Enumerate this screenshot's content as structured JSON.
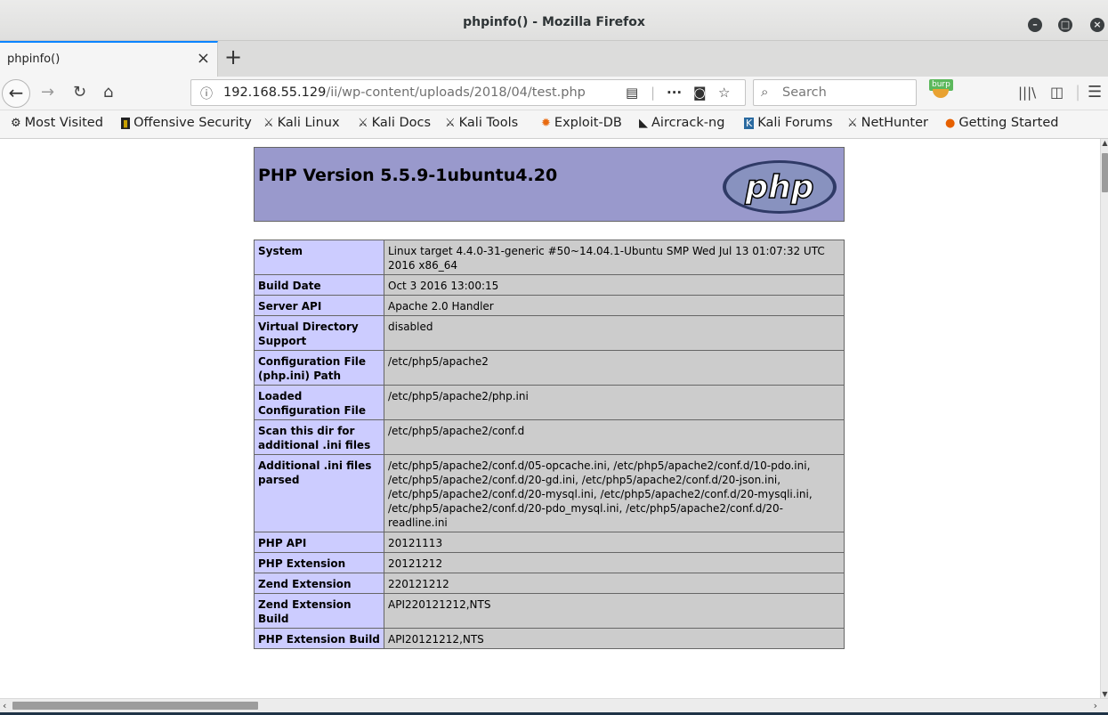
{
  "window": {
    "title": "phpinfo() - Mozilla Firefox",
    "controls": [
      "minimize",
      "maximize",
      "close"
    ]
  },
  "tabs": [
    {
      "label": "phpinfo()",
      "active": true
    }
  ],
  "nav": {
    "url_host": "192.168.55.129",
    "url_path": "/ii/wp-content/uploads/2018/04/test.php",
    "search_placeholder": "Search",
    "burp_label": "burp",
    "icons": [
      "back-icon",
      "forward-icon",
      "reload-icon",
      "home-icon",
      "info-icon",
      "reader-icon",
      "more-icon",
      "pocket-icon",
      "bookmark-star-icon",
      "search-icon",
      "library-icon",
      "sidebar-icon",
      "menu-icon"
    ]
  },
  "bookmarks": [
    {
      "label": "Most Visited",
      "icon": "gear-icon"
    },
    {
      "label": "Offensive Security",
      "icon": "offsec-icon"
    },
    {
      "label": "Kali Linux",
      "icon": "kali-icon"
    },
    {
      "label": "Kali Docs",
      "icon": "kali-icon"
    },
    {
      "label": "Kali Tools",
      "icon": "kali-icon"
    },
    {
      "label": "Exploit-DB",
      "icon": "exploitdb-icon"
    },
    {
      "label": "Aircrack-ng",
      "icon": "aircrack-icon"
    },
    {
      "label": "Kali Forums",
      "icon": "kali-forums-icon"
    },
    {
      "label": "NetHunter",
      "icon": "kali-icon"
    },
    {
      "label": "Getting Started",
      "icon": "firefox-icon"
    }
  ],
  "page": {
    "heading": "PHP Version 5.5.9-1ubuntu4.20",
    "logo_text": "php",
    "header_bg": "#9999cc",
    "key_bg": "#ccccff",
    "value_bg": "#cccccc",
    "rows": [
      {
        "key": "System",
        "value": "Linux target 4.4.0-31-generic #50~14.04.1-Ubuntu SMP Wed Jul 13 01:07:32 UTC 2016 x86_64"
      },
      {
        "key": "Build Date",
        "value": "Oct 3 2016 13:00:15"
      },
      {
        "key": "Server API",
        "value": "Apache 2.0 Handler"
      },
      {
        "key": "Virtual Directory Support",
        "value": "disabled"
      },
      {
        "key": "Configuration File (php.ini) Path",
        "value": "/etc/php5/apache2"
      },
      {
        "key": "Loaded Configuration File",
        "value": "/etc/php5/apache2/php.ini"
      },
      {
        "key": "Scan this dir for additional .ini files",
        "value": "/etc/php5/apache2/conf.d"
      },
      {
        "key": "Additional .ini files parsed",
        "value": "/etc/php5/apache2/conf.d/05-opcache.ini, /etc/php5/apache2/conf.d/10-pdo.ini, /etc/php5/apache2/conf.d/20-gd.ini, /etc/php5/apache2/conf.d/20-json.ini, /etc/php5/apache2/conf.d/20-mysql.ini, /etc/php5/apache2/conf.d/20-mysqli.ini, /etc/php5/apache2/conf.d/20-pdo_mysql.ini, /etc/php5/apache2/conf.d/20-readline.ini"
      },
      {
        "key": "PHP API",
        "value": "20121113"
      },
      {
        "key": "PHP Extension",
        "value": "20121212"
      },
      {
        "key": "Zend Extension",
        "value": "220121212"
      },
      {
        "key": "Zend Extension Build",
        "value": "API220121212,NTS"
      },
      {
        "key": "PHP Extension Build",
        "value": "API20121212,NTS"
      }
    ]
  }
}
